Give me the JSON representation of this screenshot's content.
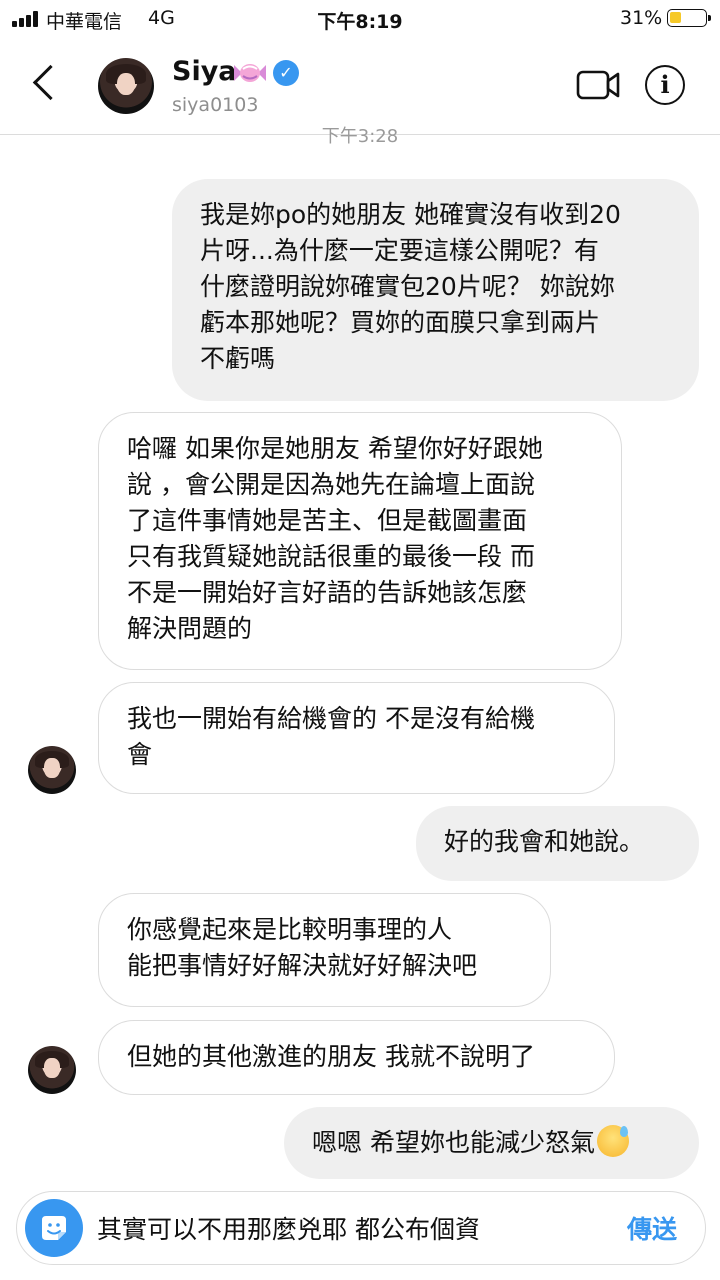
{
  "status_bar": {
    "carrier": "中華電信",
    "network": "4G",
    "time": "下午8:19",
    "battery_percent": "31%",
    "battery_level": 0.31
  },
  "header": {
    "back_icon": "chevron-left-icon",
    "contact_name": "Siya",
    "name_emoji": "candy-emoji",
    "verified_icon": "verified-badge-icon",
    "username": "siya0103",
    "video_icon": "video-camera-icon",
    "info_icon": "info-icon"
  },
  "timestamp": "下午3:28",
  "messages": [
    {
      "side": "sent",
      "text": "我是妳po的她朋友 她確實沒有收到20\n片呀...為什麼一定要這樣公開呢？有\n什麼證明說妳確實包20片呢？ 妳說妳\n虧本那她呢？買妳的面膜只拿到兩片\n不虧嗎"
    },
    {
      "side": "received",
      "text": "哈囉 如果你是她朋友 希望你好好跟她\n說 ，會公開是因為她先在論壇上面說\n了這件事情她是苦主、但是截圖畫面\n只有我質疑她說話很重的最後一段 而\n不是一開始好言好語的告訴她該怎麼\n解決問題的"
    },
    {
      "side": "received",
      "text": "我也一開始有給機會的 不是沒有給機\n會"
    },
    {
      "side": "sent",
      "text": "好的我會和她說。"
    },
    {
      "side": "received",
      "text": "你感覺起來是比較明事理的人\n能把事情好好解決就好好解決吧"
    },
    {
      "side": "received",
      "text": "但她的其他激進的朋友 我就不說明了"
    },
    {
      "side": "sent",
      "text": "嗯嗯 希望妳也能減少怒氣",
      "emoji": "sweat-smile-emoji"
    }
  ],
  "composer": {
    "sticker_icon": "sticker-icon",
    "input_value": "其實可以不用那麼兇耶 都公布個資",
    "send_label": "傳送"
  },
  "colors": {
    "accent": "#3897f0",
    "sent_bubble": "#efefef",
    "received_border": "#dcdcdc",
    "battery_fill": "#f6c928"
  }
}
